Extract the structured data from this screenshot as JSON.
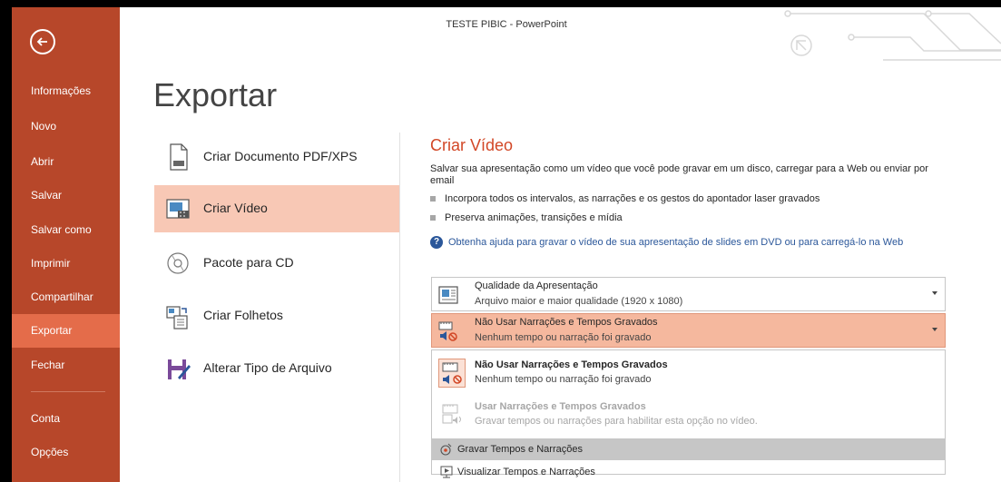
{
  "window": {
    "title": "TESTE PIBIC - PowerPoint"
  },
  "sidebar": {
    "items": [
      {
        "label": "Informações"
      },
      {
        "label": "Novo"
      },
      {
        "label": "Abrir"
      },
      {
        "label": "Salvar"
      },
      {
        "label": "Salvar como"
      },
      {
        "label": "Imprimir"
      },
      {
        "label": "Compartilhar"
      },
      {
        "label": "Exportar"
      },
      {
        "label": "Fechar"
      },
      {
        "label": "Conta"
      },
      {
        "label": "Opções"
      }
    ],
    "active": "Exportar"
  },
  "page": {
    "heading": "Exportar"
  },
  "export_options": [
    {
      "label": "Criar Documento PDF/XPS",
      "icon": "pdf-document-icon"
    },
    {
      "label": "Criar Vídeo",
      "icon": "video-icon"
    },
    {
      "label": "Pacote para CD",
      "icon": "cd-icon"
    },
    {
      "label": "Criar Folhetos",
      "icon": "handouts-icon"
    },
    {
      "label": "Alterar Tipo de Arquivo",
      "icon": "save-as-type-icon"
    }
  ],
  "detail": {
    "heading": "Criar Vídeo",
    "description": "Salvar sua apresentação como um vídeo que você pode gravar em um disco, carregar para a Web ou enviar por email",
    "bullets": [
      "Incorpora todos os intervalos, as narrações e os gestos do apontador laser gravados",
      "Preserva animações, transições e mídia"
    ],
    "help_link": "Obtenha ajuda para gravar o vídeo de sua apresentação de slides em DVD ou para carregá-lo na Web"
  },
  "quality_dropdown": {
    "title": "Qualidade da Apresentação",
    "subtitle": "Arquivo maior e maior qualidade (1920 x 1080)"
  },
  "narration_dropdown": {
    "title": "Não Usar Narrações e Tempos Gravados",
    "subtitle": "Nenhum tempo ou narração foi gravado"
  },
  "menu": {
    "options": [
      {
        "title": "Não Usar Narrações e Tempos Gravados",
        "subtitle": "Nenhum tempo ou narração foi gravado",
        "enabled": true
      },
      {
        "title": "Usar Narrações e Tempos Gravados",
        "subtitle": "Gravar tempos ou narrações para habilitar esta opção no vídeo.",
        "enabled": false
      }
    ],
    "commands": [
      {
        "label": "Gravar Tempos e Narrações"
      },
      {
        "label": "Visualizar Tempos e Narrações"
      }
    ]
  },
  "colors": {
    "sidebar": "#b7472a",
    "sidebar_active": "#e46c4a",
    "accent": "#d24726",
    "selection": "#f8c8b5"
  }
}
